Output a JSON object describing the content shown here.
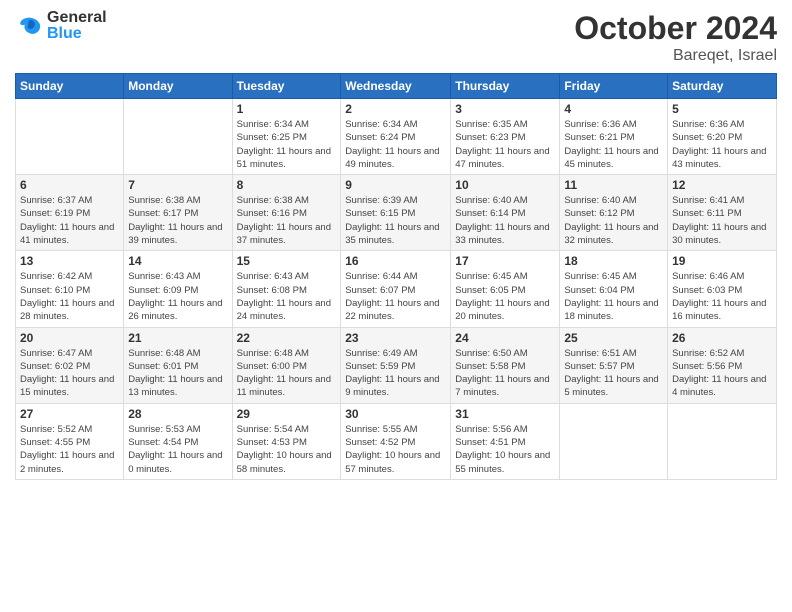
{
  "header": {
    "logo_general": "General",
    "logo_blue": "Blue",
    "month_title": "October 2024",
    "location": "Bareqet, Israel"
  },
  "days_of_week": [
    "Sunday",
    "Monday",
    "Tuesday",
    "Wednesday",
    "Thursday",
    "Friday",
    "Saturday"
  ],
  "weeks": [
    [
      {
        "day": "",
        "info": ""
      },
      {
        "day": "",
        "info": ""
      },
      {
        "day": "1",
        "info": "Sunrise: 6:34 AM\nSunset: 6:25 PM\nDaylight: 11 hours and 51 minutes."
      },
      {
        "day": "2",
        "info": "Sunrise: 6:34 AM\nSunset: 6:24 PM\nDaylight: 11 hours and 49 minutes."
      },
      {
        "day": "3",
        "info": "Sunrise: 6:35 AM\nSunset: 6:23 PM\nDaylight: 11 hours and 47 minutes."
      },
      {
        "day": "4",
        "info": "Sunrise: 6:36 AM\nSunset: 6:21 PM\nDaylight: 11 hours and 45 minutes."
      },
      {
        "day": "5",
        "info": "Sunrise: 6:36 AM\nSunset: 6:20 PM\nDaylight: 11 hours and 43 minutes."
      }
    ],
    [
      {
        "day": "6",
        "info": "Sunrise: 6:37 AM\nSunset: 6:19 PM\nDaylight: 11 hours and 41 minutes."
      },
      {
        "day": "7",
        "info": "Sunrise: 6:38 AM\nSunset: 6:17 PM\nDaylight: 11 hours and 39 minutes."
      },
      {
        "day": "8",
        "info": "Sunrise: 6:38 AM\nSunset: 6:16 PM\nDaylight: 11 hours and 37 minutes."
      },
      {
        "day": "9",
        "info": "Sunrise: 6:39 AM\nSunset: 6:15 PM\nDaylight: 11 hours and 35 minutes."
      },
      {
        "day": "10",
        "info": "Sunrise: 6:40 AM\nSunset: 6:14 PM\nDaylight: 11 hours and 33 minutes."
      },
      {
        "day": "11",
        "info": "Sunrise: 6:40 AM\nSunset: 6:12 PM\nDaylight: 11 hours and 32 minutes."
      },
      {
        "day": "12",
        "info": "Sunrise: 6:41 AM\nSunset: 6:11 PM\nDaylight: 11 hours and 30 minutes."
      }
    ],
    [
      {
        "day": "13",
        "info": "Sunrise: 6:42 AM\nSunset: 6:10 PM\nDaylight: 11 hours and 28 minutes."
      },
      {
        "day": "14",
        "info": "Sunrise: 6:43 AM\nSunset: 6:09 PM\nDaylight: 11 hours and 26 minutes."
      },
      {
        "day": "15",
        "info": "Sunrise: 6:43 AM\nSunset: 6:08 PM\nDaylight: 11 hours and 24 minutes."
      },
      {
        "day": "16",
        "info": "Sunrise: 6:44 AM\nSunset: 6:07 PM\nDaylight: 11 hours and 22 minutes."
      },
      {
        "day": "17",
        "info": "Sunrise: 6:45 AM\nSunset: 6:05 PM\nDaylight: 11 hours and 20 minutes."
      },
      {
        "day": "18",
        "info": "Sunrise: 6:45 AM\nSunset: 6:04 PM\nDaylight: 11 hours and 18 minutes."
      },
      {
        "day": "19",
        "info": "Sunrise: 6:46 AM\nSunset: 6:03 PM\nDaylight: 11 hours and 16 minutes."
      }
    ],
    [
      {
        "day": "20",
        "info": "Sunrise: 6:47 AM\nSunset: 6:02 PM\nDaylight: 11 hours and 15 minutes."
      },
      {
        "day": "21",
        "info": "Sunrise: 6:48 AM\nSunset: 6:01 PM\nDaylight: 11 hours and 13 minutes."
      },
      {
        "day": "22",
        "info": "Sunrise: 6:48 AM\nSunset: 6:00 PM\nDaylight: 11 hours and 11 minutes."
      },
      {
        "day": "23",
        "info": "Sunrise: 6:49 AM\nSunset: 5:59 PM\nDaylight: 11 hours and 9 minutes."
      },
      {
        "day": "24",
        "info": "Sunrise: 6:50 AM\nSunset: 5:58 PM\nDaylight: 11 hours and 7 minutes."
      },
      {
        "day": "25",
        "info": "Sunrise: 6:51 AM\nSunset: 5:57 PM\nDaylight: 11 hours and 5 minutes."
      },
      {
        "day": "26",
        "info": "Sunrise: 6:52 AM\nSunset: 5:56 PM\nDaylight: 11 hours and 4 minutes."
      }
    ],
    [
      {
        "day": "27",
        "info": "Sunrise: 5:52 AM\nSunset: 4:55 PM\nDaylight: 11 hours and 2 minutes."
      },
      {
        "day": "28",
        "info": "Sunrise: 5:53 AM\nSunset: 4:54 PM\nDaylight: 11 hours and 0 minutes."
      },
      {
        "day": "29",
        "info": "Sunrise: 5:54 AM\nSunset: 4:53 PM\nDaylight: 10 hours and 58 minutes."
      },
      {
        "day": "30",
        "info": "Sunrise: 5:55 AM\nSunset: 4:52 PM\nDaylight: 10 hours and 57 minutes."
      },
      {
        "day": "31",
        "info": "Sunrise: 5:56 AM\nSunset: 4:51 PM\nDaylight: 10 hours and 55 minutes."
      },
      {
        "day": "",
        "info": ""
      },
      {
        "day": "",
        "info": ""
      }
    ]
  ]
}
